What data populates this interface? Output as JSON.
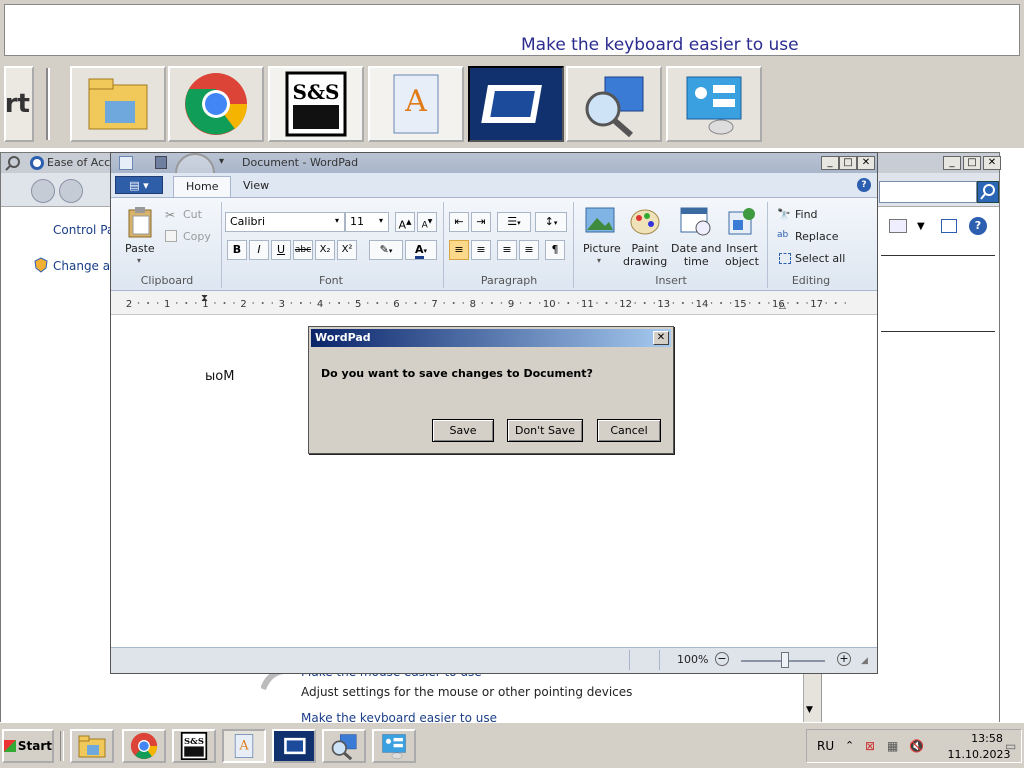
{
  "magnifier": {
    "text": "Make the keyboard easier to use",
    "start_fragment": "rt"
  },
  "control_panel": {
    "title": "Ease of Acc",
    "links": [
      "Control Pan",
      "Change adm"
    ],
    "bottom": {
      "mouse_link": "Make the mouse easier to use",
      "mouse_desc": "Adjust settings for the mouse or other pointing devices",
      "keyboard_link": "Make the keyboard easier to use"
    }
  },
  "wordpad": {
    "title": "Document - WordPad",
    "tabs": [
      "Home",
      "View"
    ],
    "clipboard": {
      "paste": "Paste",
      "cut": "Cut",
      "copy": "Copy",
      "label": "Clipboard"
    },
    "font": {
      "family": "Calibri",
      "size": "11",
      "label": "Font",
      "buttons": [
        "B",
        "I",
        "U",
        "abc",
        "X₂",
        "X²"
      ]
    },
    "paragraph": {
      "label": "Paragraph"
    },
    "insert": {
      "label": "Insert",
      "picture": "Picture",
      "paint": "Paint\ndrawing",
      "date": "Date and\ntime",
      "object": "Insert\nobject"
    },
    "editing": {
      "label": "Editing",
      "find": "Find",
      "replace": "Replace",
      "select_all": "Select all"
    },
    "ruler_numbers": [
      "2",
      "1",
      "1",
      "2",
      "3",
      "4",
      "5",
      "6",
      "7",
      "8",
      "9",
      "10",
      "11",
      "12",
      "13",
      "14",
      "15",
      "16",
      "17"
    ],
    "document_text": "ыоМ",
    "zoom": "100%"
  },
  "dialog": {
    "title": "WordPad",
    "message": "Do you want to save changes to Document?",
    "save": "Save",
    "dont_save": "Don't Save",
    "cancel": "Cancel"
  },
  "taskbar": {
    "start": "Start",
    "language": "RU",
    "time": "13:58",
    "date": "11.10.2023"
  }
}
